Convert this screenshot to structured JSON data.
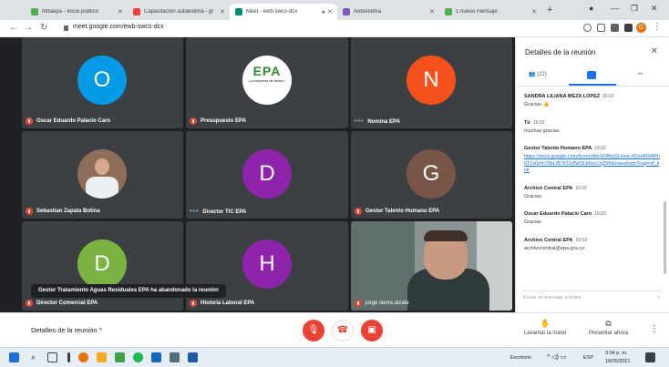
{
  "browser": {
    "tabs": [
      {
        "label": "Intraepa - Inicio publico",
        "color": "#4caf50"
      },
      {
        "label": "Capacitación autoestima - gr",
        "color": "#ea4335"
      },
      {
        "label": "Meet - ewb-swcs-dcx",
        "color": "#00897b"
      },
      {
        "label": "Autoestima",
        "color": "#7e57c2"
      },
      {
        "label": "1 nuevo mensaje",
        "color": "#4caf50"
      }
    ],
    "url": "meet.google.com/ewb-swcs-dcx",
    "profile_initial": "G"
  },
  "tiles": [
    {
      "name": "Oscar Eduardo Palacio Caro",
      "kind": "letter",
      "letter": "O",
      "color": "#039be5",
      "muted": true
    },
    {
      "name": "Presupuesto EPA",
      "kind": "logo",
      "muted": true
    },
    {
      "name": "Nomina EPA",
      "kind": "letter",
      "letter": "N",
      "color": "#f4511e",
      "muted": false
    },
    {
      "name": "Sebastian Zapata Botina",
      "kind": "photo",
      "muted": true
    },
    {
      "name": "Director TIC EPA",
      "kind": "letter",
      "letter": "D",
      "color": "#8e24aa",
      "muted": false
    },
    {
      "name": "Gestor Talento Humano EPA",
      "kind": "letter",
      "letter": "G",
      "color": "#795548",
      "muted": true
    },
    {
      "name": "Director Comercial EPA",
      "kind": "letter",
      "letter": "D",
      "color": "#7cb342",
      "muted": true
    },
    {
      "name": "Historia Laboral EPA",
      "kind": "letter",
      "letter": "H",
      "color": "#8e24aa",
      "muted": true
    },
    {
      "name": "jorge sierra alzate",
      "kind": "camera",
      "muted": true
    }
  ],
  "logo": {
    "big": "EPA",
    "slogan": "La empresa de todos !"
  },
  "toast": "Gestor Tratamiento Aguas Residuales EPA ha abandonado la reunión",
  "panel": {
    "title": "Detalles de la reunión",
    "people_count": "(22)",
    "messages": [
      {
        "sender": "SANDRA LILIANA MEZA LOPEZ",
        "time": "15:02",
        "text": "Gracias 👍",
        "link": ""
      },
      {
        "sender": "Tú",
        "time": "15:02",
        "text": "muchas gracias",
        "link": ""
      },
      {
        "sender": "Gestor Talento Humano EPA",
        "time": "15:02",
        "text": "",
        "link": "https://docs.google.com/forms/d/e/1FAIpQLSea-XDzef0hAPh0T2x0zth79bL8f783Jr8W3Lb0xcCq25ihb/viewform?usp=sf_link"
      },
      {
        "sender": "Archivo Central EPA",
        "time": "15:02",
        "text": "Gracias",
        "link": ""
      },
      {
        "sender": "Oscar Eduardo Palacio Caro",
        "time": "15:03",
        "text": "Gracias",
        "link": ""
      },
      {
        "sender": "Archivo Central EPA",
        "time": "15:03",
        "text": "archivocentral@epa.gov.co",
        "link": ""
      }
    ],
    "input_placeholder": "Envía un mensaje a todos"
  },
  "controls": {
    "details_label": "Detalles de la reunión",
    "raise_hand": "Levantar la mano",
    "present_now": "Presentar ahora"
  },
  "taskbar": {
    "desktop_label": "Escritorio",
    "lang": "ESP",
    "time": "3:04 p. m.",
    "date": "18/05/2021"
  }
}
